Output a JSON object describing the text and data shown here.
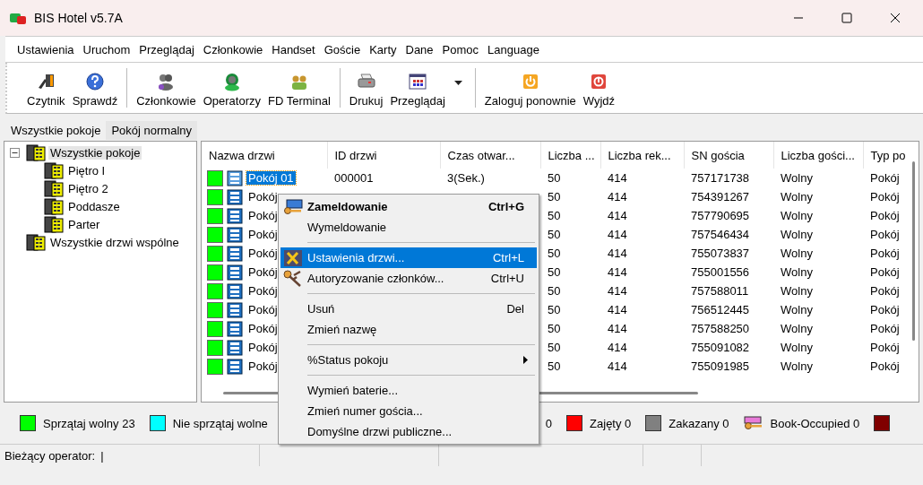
{
  "window": {
    "title": "BIS Hotel v5.7A"
  },
  "menu_bar": [
    "Ustawienia",
    "Uruchom",
    "Przeglądaj",
    "Członkowie",
    "Handset",
    "Goście",
    "Karty",
    "Dane",
    "Pomoc",
    "Language"
  ],
  "toolbar": [
    [
      {
        "label": "Czytnik",
        "dropdown": false
      },
      {
        "label": "Sprawdź",
        "dropdown": false
      }
    ],
    [
      {
        "label": "Członkowie",
        "dropdown": false
      },
      {
        "label": "Operatorzy",
        "dropdown": false
      },
      {
        "label": "FD Terminal",
        "dropdown": false
      }
    ],
    [
      {
        "label": "Drukuj",
        "dropdown": false
      },
      {
        "label": "Przeglądaj",
        "dropdown": true
      }
    ],
    [
      {
        "label": "Zaloguj ponownie",
        "dropdown": false
      },
      {
        "label": "Wyjdź",
        "dropdown": false
      }
    ]
  ],
  "tabs": [
    {
      "label": "Wszystkie pokoje",
      "selected": true
    },
    {
      "label": "Pokój normalny",
      "selected": false
    }
  ],
  "tree": [
    {
      "label": "Wszystkie pokoje",
      "expanded": true,
      "selected": true,
      "children": [
        {
          "label": "Piętro I"
        },
        {
          "label": "Piętro 2"
        },
        {
          "label": "Poddasze"
        },
        {
          "label": "Parter"
        }
      ]
    },
    {
      "label": "Wszystkie drzwi wspólne",
      "selected": false
    }
  ],
  "table": {
    "columns": [
      "Nazwa drzwi",
      "ID drzwi",
      "Czas otwar...",
      "Liczba ...",
      "Liczba rek...",
      "SN gościa",
      "Liczba gości...",
      "Typ po"
    ],
    "rows": [
      {
        "color": "#00ff00",
        "selected": true,
        "cells": [
          "Pokój 01",
          "000001",
          "3(Sek.)",
          "50",
          "414",
          "757171738",
          "Wolny",
          "Pokój"
        ]
      },
      {
        "color": "#00ff00",
        "selected": false,
        "cells": [
          "Pokój",
          "",
          "",
          "50",
          "414",
          "754391267",
          "Wolny",
          "Pokój"
        ]
      },
      {
        "color": "#00ff00",
        "selected": false,
        "cells": [
          "Pokój",
          "",
          "",
          "50",
          "414",
          "757790695",
          "Wolny",
          "Pokój"
        ]
      },
      {
        "color": "#00ff00",
        "selected": false,
        "cells": [
          "Pokój",
          "",
          "",
          "50",
          "414",
          "757546434",
          "Wolny",
          "Pokój"
        ]
      },
      {
        "color": "#00ff00",
        "selected": false,
        "cells": [
          "Pokój",
          "",
          "",
          "50",
          "414",
          "755073837",
          "Wolny",
          "Pokój"
        ]
      },
      {
        "color": "#00ff00",
        "selected": false,
        "cells": [
          "Pokój",
          "",
          "",
          "50",
          "414",
          "755001556",
          "Wolny",
          "Pokój"
        ]
      },
      {
        "color": "#00ff00",
        "selected": false,
        "cells": [
          "Pokój",
          "",
          "",
          "50",
          "414",
          "757588011",
          "Wolny",
          "Pokój"
        ]
      },
      {
        "color": "#00ff00",
        "selected": false,
        "cells": [
          "Pokój",
          "",
          "",
          "50",
          "414",
          "756512445",
          "Wolny",
          "Pokój"
        ]
      },
      {
        "color": "#00ff00",
        "selected": false,
        "cells": [
          "Pokój",
          "",
          "",
          "50",
          "414",
          "757588250",
          "Wolny",
          "Pokój"
        ]
      },
      {
        "color": "#00ff00",
        "selected": false,
        "cells": [
          "Pokój",
          "",
          "",
          "50",
          "414",
          "755091082",
          "Wolny",
          "Pokój"
        ]
      },
      {
        "color": "#00ff00",
        "selected": false,
        "cells": [
          "Pokój",
          "",
          "",
          "50",
          "414",
          "755091985",
          "Wolny",
          "Pokój"
        ]
      }
    ]
  },
  "context_menu": [
    {
      "kind": "item",
      "label": "Zameldowanie",
      "shortcut": "Ctrl+G",
      "default": true,
      "selected": false,
      "submenu": false
    },
    {
      "kind": "item",
      "label": "Wymeldowanie",
      "default": false,
      "selected": false,
      "submenu": false
    },
    {
      "kind": "separator"
    },
    {
      "kind": "item",
      "label": "Ustawienia drzwi...",
      "shortcut": "Ctrl+L",
      "default": false,
      "selected": true,
      "submenu": false
    },
    {
      "kind": "item",
      "label": "Autoryzowanie członków...",
      "shortcut": "Ctrl+U",
      "default": false,
      "selected": false,
      "submenu": false
    },
    {
      "kind": "separator"
    },
    {
      "kind": "item",
      "label": "Usuń",
      "shortcut": "Del",
      "default": false,
      "selected": false,
      "submenu": false
    },
    {
      "kind": "item",
      "label": "Zmień nazwę",
      "default": false,
      "selected": false,
      "submenu": false
    },
    {
      "kind": "separator"
    },
    {
      "kind": "item",
      "label": "%Status pokoju",
      "submenu": true,
      "default": false,
      "selected": false
    },
    {
      "kind": "separator"
    },
    {
      "kind": "item",
      "label": "Wymień baterie...",
      "default": false,
      "selected": false,
      "submenu": false
    },
    {
      "kind": "item",
      "label": "Zmień numer gościa...",
      "default": false,
      "selected": false,
      "submenu": false
    },
    {
      "kind": "item",
      "label": "Domyślne drzwi publiczne...",
      "default": false,
      "selected": false,
      "submenu": false
    }
  ],
  "legend": [
    {
      "kind": "swatch",
      "color": "#00ff00",
      "label": "Sprzątaj wolny 23"
    },
    {
      "kind": "swatch",
      "color": "#00ffff",
      "label": "Nie sprzątaj wolne"
    },
    {
      "kind": "text",
      "label": "0"
    },
    {
      "kind": "swatch",
      "color": "#ff0000",
      "label": "Zajęty 0"
    },
    {
      "kind": "swatch",
      "color": "#808080",
      "label": "Zakazany 0"
    },
    {
      "kind": "key",
      "label": "Book-Occupied 0"
    },
    {
      "kind": "swatch",
      "color": "#800000"
    }
  ],
  "status_bar": {
    "operator_label": "Bieżący operator:",
    "operator_value": "|"
  }
}
